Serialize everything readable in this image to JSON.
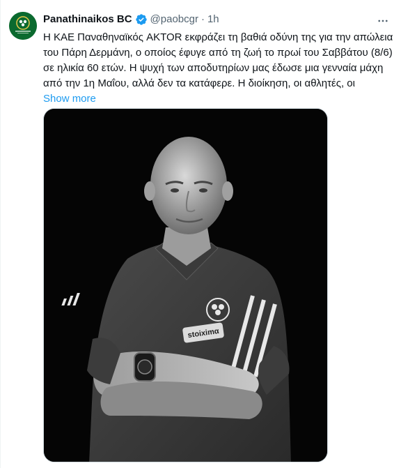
{
  "author": {
    "display_name": "Panathinaikos BC",
    "handle": "@paobcgr",
    "separator": "·",
    "time": "1h",
    "verified": true,
    "avatar_icon": "club-crest-icon",
    "avatar_color": "#0b6a2f"
  },
  "tweet": {
    "text": "Η ΚΑΕ Παναθηναϊκός AKTOR εκφράζει τη βαθιά οδύνη της για την απώλεια του Πάρη Δερμάνη, ο οποίος έφυγε από τη ζωή το πρωί του Σαββάτου (8/6) σε ηλικία 60 ετών. Η ψυχή των αποδυτηρίων μας έδωσε μια γενναία μάχη από την 1η Μαΐου, αλλά δεν τα κατάφερε. Η διοίκηση, οι αθλητές, οι",
    "show_more": "Show more"
  },
  "media": {
    "jersey_sponsor": "stoiximα",
    "photo_style": "black-and-white portrait"
  },
  "colors": {
    "link": "#1d9bf0",
    "secondary_text": "#536471",
    "verified": "#1d9bf0"
  }
}
